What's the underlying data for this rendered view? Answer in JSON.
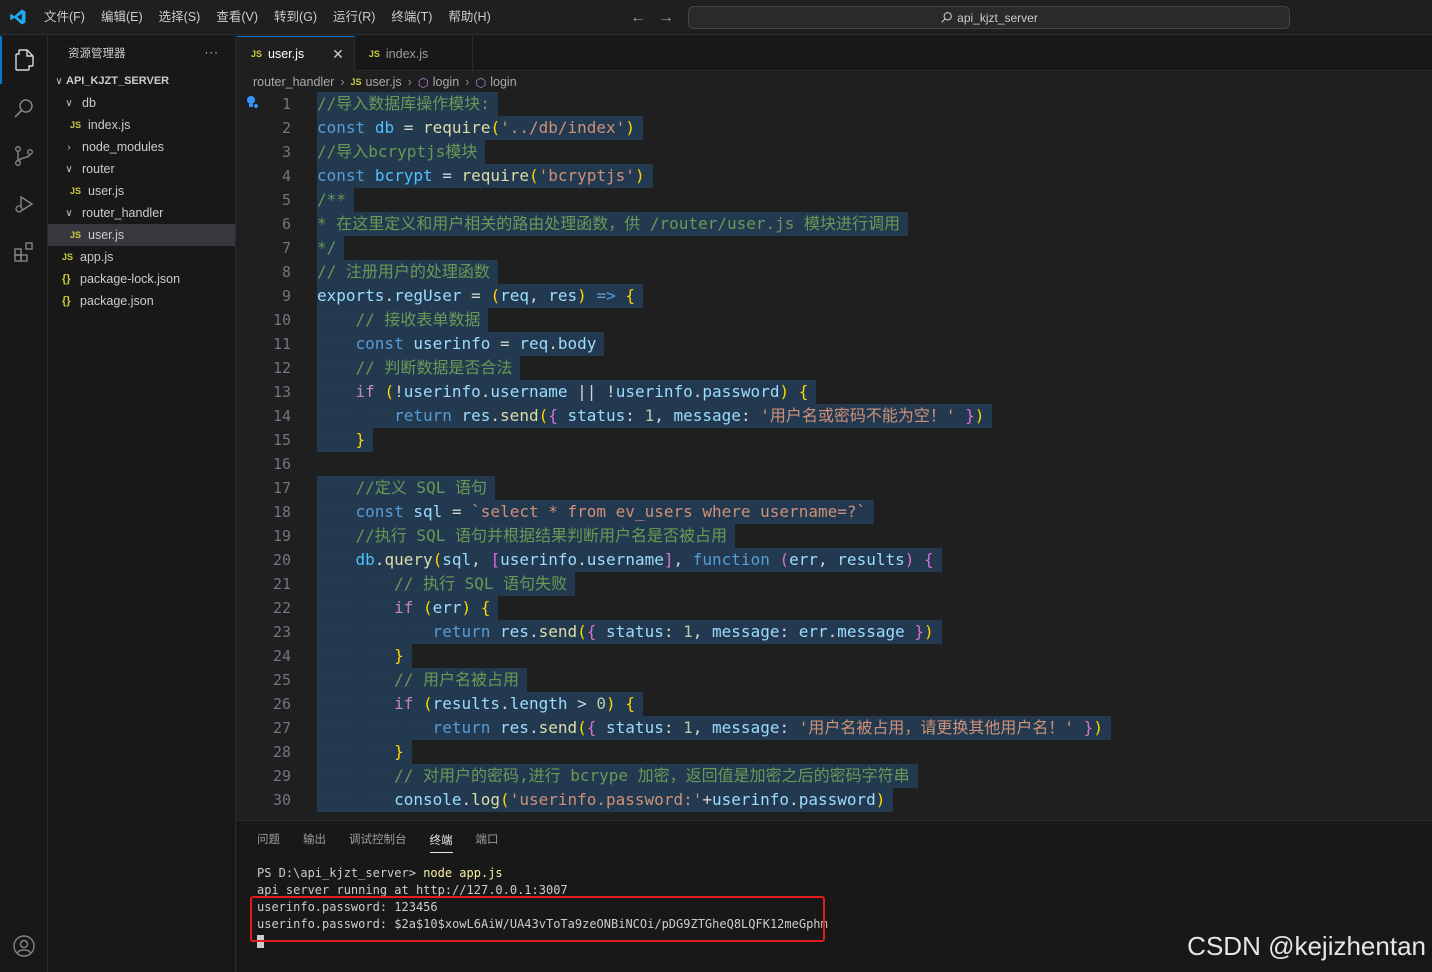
{
  "menu": [
    "文件(F)",
    "编辑(E)",
    "选择(S)",
    "查看(V)",
    "转到(G)",
    "运行(R)",
    "终端(T)",
    "帮助(H)"
  ],
  "search": {
    "text": "api_kjzt_server"
  },
  "sidebar": {
    "title": "资源管理器",
    "more": "···",
    "root": "API_KJZT_SERVER",
    "items": [
      {
        "label": "db",
        "type": "folder-open",
        "depth": 1
      },
      {
        "label": "index.js",
        "type": "js",
        "depth": 2
      },
      {
        "label": "node_modules",
        "type": "folder-closed",
        "depth": 1
      },
      {
        "label": "router",
        "type": "folder-open",
        "depth": 1
      },
      {
        "label": "user.js",
        "type": "js",
        "depth": 2
      },
      {
        "label": "router_handler",
        "type": "folder-open",
        "depth": 1
      },
      {
        "label": "user.js",
        "type": "js",
        "depth": 2,
        "selected": true
      },
      {
        "label": "app.js",
        "type": "js",
        "depth": 1
      },
      {
        "label": "package-lock.json",
        "type": "json",
        "depth": 1
      },
      {
        "label": "package.json",
        "type": "json",
        "depth": 1
      }
    ]
  },
  "tabs": [
    {
      "label": "user.js",
      "active": true
    },
    {
      "label": "index.js",
      "active": false
    }
  ],
  "breadcrumb": [
    "router_handler",
    "user.js",
    "login",
    "login"
  ],
  "code_lines": [
    "//导入数据库操作模块:",
    "const db = require('../db/index')",
    "//导入bcryptjs模块",
    "const bcrypt = require('bcryptjs')",
    "/**",
    "* 在这里定义和用户相关的路由处理函数，供 /router/user.js 模块进行调用",
    "*/",
    "// 注册用户的处理函数",
    "exports.regUser = (req, res) => {",
    "    // 接收表单数据",
    "    const userinfo = req.body",
    "    // 判断数据是否合法",
    "    if (!userinfo.username || !userinfo.password) {",
    "        return res.send({ status: 1, message: '用户名或密码不能为空！' })",
    "    }",
    "",
    "    //定义 SQL 语句",
    "    const sql = `select * from ev_users where username=?`",
    "    //执行 SQL 语句并根据结果判断用户名是否被占用",
    "    db.query(sql, [userinfo.username], function (err, results) {",
    "        // 执行 SQL 语句失败",
    "        if (err) {",
    "            return res.send({ status: 1, message: err.message })",
    "        }",
    "        // 用户名被占用",
    "        if (results.length > 0) {",
    "            return res.send({ status: 1, message: '用户名被占用，请更换其他用户名！' })",
    "        }",
    "        // 对用户的密码,进行 bcrype 加密，返回值是加密之后的密码字符串",
    "        console.log('userinfo.password:'+userinfo.password)"
  ],
  "panel": {
    "tabs": [
      "问题",
      "输出",
      "调试控制台",
      "终端",
      "端口"
    ],
    "active_tab": "终端",
    "terminal": {
      "prompt": "PS D:\\api_kjzt_server>",
      "command": "node app.js",
      "lines": [
        "api server running at http://127.0.0.1:3007",
        "userinfo.password: 123456",
        "userinfo.password: $2a$10$xowL6AiW/UA43vToTa9zeONBiNCOi/pDG9ZTGheQ8LQFK12meGphm"
      ]
    }
  },
  "watermark": "CSDN @kejizhentan",
  "colors": {
    "accent": "#0078d4",
    "highlight_box": "#e31d1d",
    "selection": "#264f78"
  }
}
